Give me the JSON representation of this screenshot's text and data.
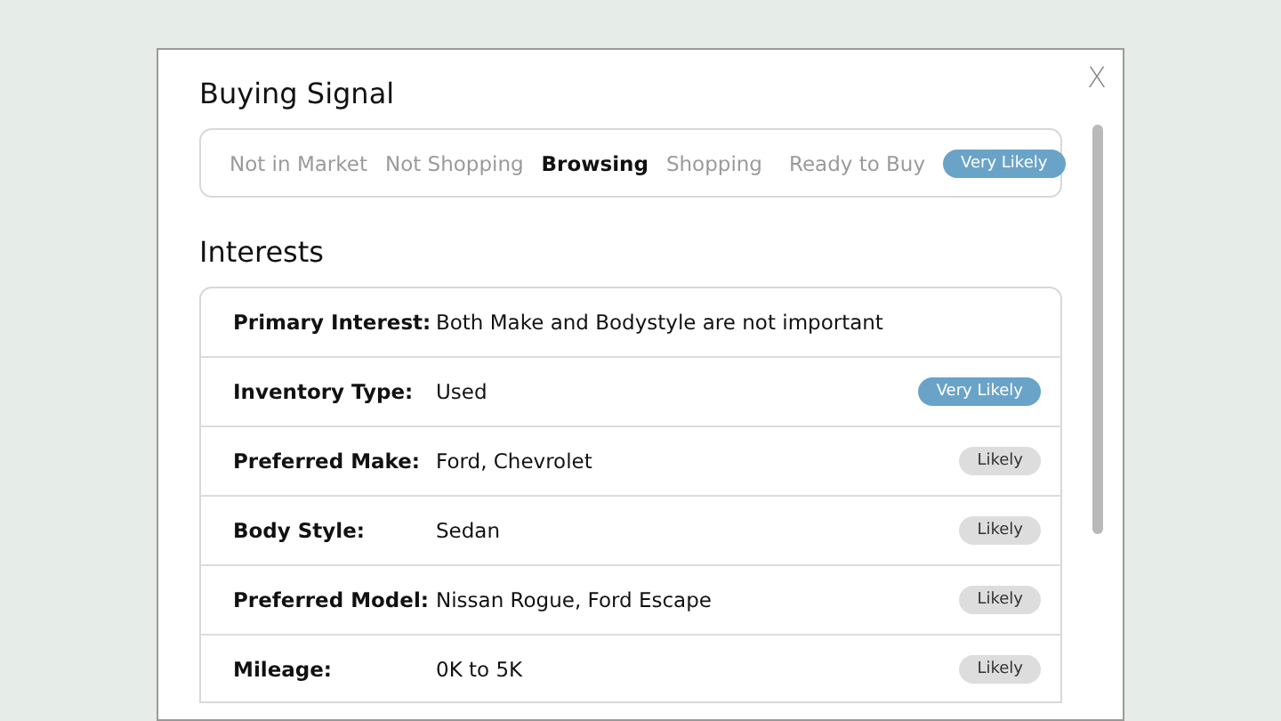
{
  "modal": {
    "close_label": "X"
  },
  "buying_signal": {
    "title": "Buying Signal",
    "stages": [
      {
        "label": "Not in Market",
        "selected": false
      },
      {
        "label": "Not Shopping",
        "selected": false
      },
      {
        "label": "Browsing",
        "selected": true
      },
      {
        "label": "Shopping",
        "selected": false
      },
      {
        "label": "Ready to Buy",
        "selected": false
      }
    ],
    "badge": {
      "kind": "very-likely",
      "label": "Very Likely"
    }
  },
  "interests": {
    "title": "Interests",
    "rows": [
      {
        "label": "Primary Interest:",
        "value": "Both Make and Bodystyle are not important"
      },
      {
        "label": "Inventory Type:",
        "value": "Used",
        "badge": {
          "kind": "very-likely",
          "label": "Very Likely"
        }
      },
      {
        "label": "Preferred Make:",
        "value": "Ford, Chevrolet",
        "badge": {
          "kind": "likely",
          "label": "Likely"
        }
      },
      {
        "label": "Body Style:",
        "value": "Sedan",
        "badge": {
          "kind": "likely",
          "label": "Likely"
        }
      },
      {
        "label": "Preferred Model:",
        "value": "Nissan Rogue, Ford Escape",
        "badge": {
          "kind": "likely",
          "label": "Likely"
        }
      },
      {
        "label": "Mileage:",
        "value": "0K to 5K",
        "badge": {
          "kind": "likely",
          "label": "Likely"
        }
      }
    ]
  }
}
